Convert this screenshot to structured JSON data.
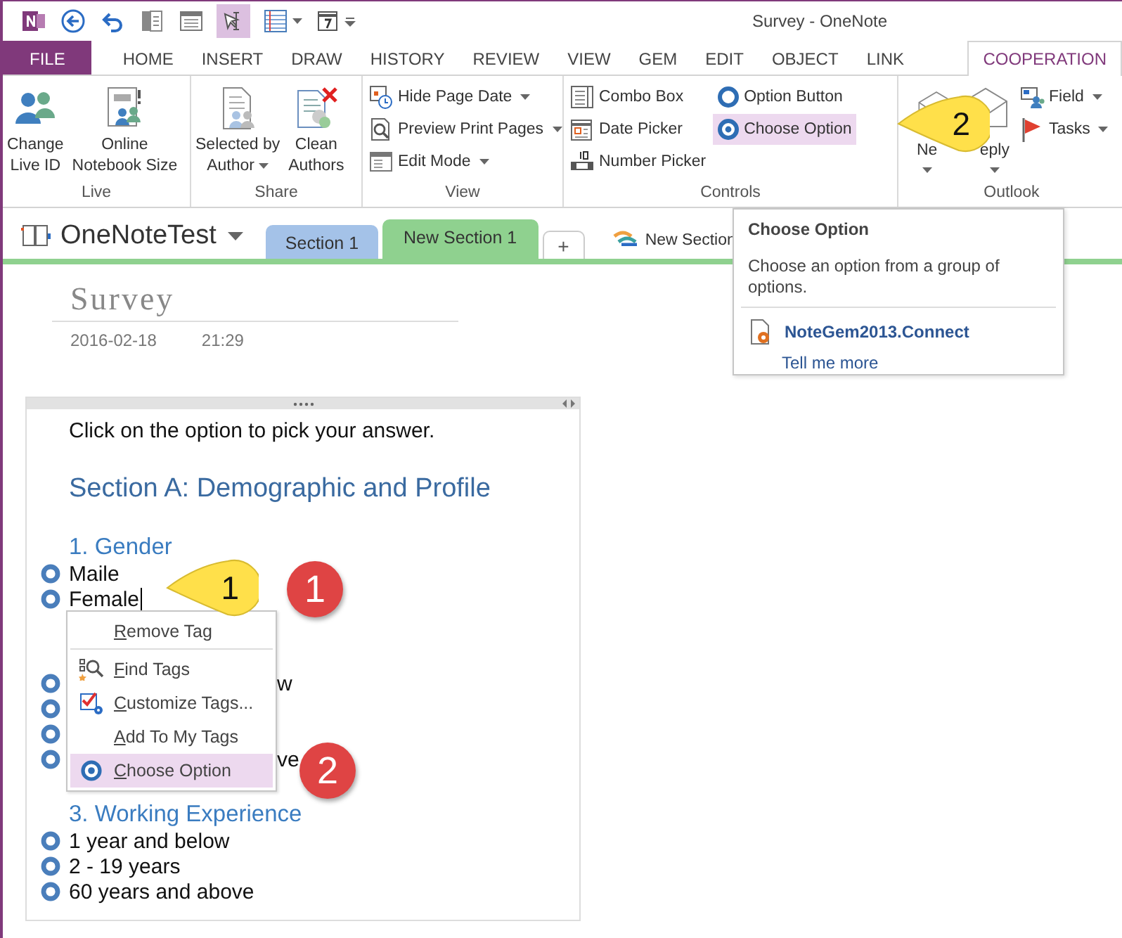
{
  "window": {
    "title": "Survey - OneNote"
  },
  "tabs": [
    {
      "label": "FILE",
      "kind": "file",
      "selected": false
    },
    {
      "label": "HOME",
      "kind": "tab",
      "selected": false
    },
    {
      "label": "INSERT",
      "kind": "tab",
      "selected": false
    },
    {
      "label": "DRAW",
      "kind": "tab",
      "selected": false
    },
    {
      "label": "HISTORY",
      "kind": "tab",
      "selected": false
    },
    {
      "label": "REVIEW",
      "kind": "tab",
      "selected": false
    },
    {
      "label": "VIEW",
      "kind": "tab",
      "selected": false
    },
    {
      "label": "GEM",
      "kind": "tab",
      "selected": false
    },
    {
      "label": "EDIT",
      "kind": "tab",
      "selected": false
    },
    {
      "label": "OBJECT",
      "kind": "tab",
      "selected": false
    },
    {
      "label": "LINK",
      "kind": "tab",
      "selected": false
    },
    {
      "label": "COOPERATION",
      "kind": "tab",
      "selected": true
    }
  ],
  "ribbon_groups": [
    {
      "label": "Live",
      "items": [
        {
          "kind": "large",
          "lines": [
            "Change",
            "Live ID"
          ],
          "dropdown": false
        },
        {
          "kind": "large",
          "lines": [
            "Online",
            "Notebook Size"
          ],
          "dropdown": false
        }
      ]
    },
    {
      "label": "Share",
      "items": [
        {
          "kind": "large",
          "lines": [
            "Selected by",
            "Author"
          ],
          "dropdown": true
        },
        {
          "kind": "large",
          "lines": [
            "Clean",
            "Authors"
          ],
          "dropdown": false
        }
      ]
    },
    {
      "label": "View",
      "items": [
        {
          "kind": "small",
          "lines": [
            "Hide Page Date"
          ],
          "dropdown": true,
          "highlighted": false
        },
        {
          "kind": "small",
          "lines": [
            "Preview Print Pages"
          ],
          "dropdown": true,
          "highlighted": false
        },
        {
          "kind": "small",
          "lines": [
            "Edit Mode"
          ],
          "dropdown": true,
          "highlighted": false
        }
      ]
    },
    {
      "label": "Controls",
      "items": [
        {
          "kind": "small",
          "lines": [
            "Combo Box"
          ],
          "dropdown": false,
          "highlighted": false
        },
        {
          "kind": "small",
          "lines": [
            "Date Picker"
          ],
          "dropdown": false,
          "highlighted": false
        },
        {
          "kind": "small",
          "lines": [
            "Number Picker"
          ],
          "dropdown": false,
          "highlighted": false
        },
        {
          "kind": "small",
          "lines": [
            "Option Button"
          ],
          "dropdown": false,
          "highlighted": false
        },
        {
          "kind": "small",
          "lines": [
            "Choose Option"
          ],
          "dropdown": false,
          "highlighted": true
        }
      ]
    },
    {
      "label": "Outlook",
      "items": [
        {
          "kind": "large",
          "lines": [
            "Ne"
          ],
          "dropdown": true
        },
        {
          "kind": "large",
          "lines": [
            "eply"
          ],
          "dropdown": true
        },
        {
          "kind": "small",
          "lines": [
            "Field"
          ],
          "dropdown": true,
          "highlighted": false
        },
        {
          "kind": "small",
          "lines": [
            "Tasks"
          ],
          "dropdown": true,
          "highlighted": false
        }
      ]
    }
  ],
  "notebook": {
    "name": "OneNoteTest"
  },
  "sections": [
    {
      "label": "Section 1",
      "color": "#a4c2e8",
      "selected": false
    },
    {
      "label": "New Section 1",
      "color": "#8fd18f",
      "selected": true
    }
  ],
  "add_section": "+",
  "section_group": "New Section",
  "page": {
    "title": "Survey",
    "date": "2016-02-18",
    "time": "21:29"
  },
  "note": {
    "instruction": "Click on the option to pick your answer.",
    "section_heading": "Section A: Demographic and Profile",
    "questions": [
      {
        "heading": "1. Gender",
        "options": [
          {
            "text": "Maile",
            "cursor": false,
            "covered": false
          },
          {
            "text": "Female",
            "cursor": true,
            "covered": false
          }
        ]
      },
      {
        "options": [
          {
            "text": "w",
            "cursor": false,
            "covered": true
          },
          {
            "covered": true
          },
          {
            "covered": true
          },
          {
            "text": "ve",
            "cursor": false,
            "covered": true
          }
        ]
      },
      {
        "heading": "3. Working Experience",
        "options": [
          {
            "text": "1 year and below",
            "cursor": false,
            "covered": false
          },
          {
            "text": "2 - 19 years",
            "cursor": false,
            "covered": false
          },
          {
            "text": "60 years and above",
            "cursor": false,
            "covered": false
          }
        ]
      }
    ]
  },
  "context_menu": [
    {
      "label": "Remove Tag",
      "selected": false,
      "separator_after": true
    },
    {
      "label": "Find Tags",
      "selected": false,
      "separator_after": false
    },
    {
      "label": "Customize Tags...",
      "selected": false,
      "separator_after": false
    },
    {
      "label": "Add To My Tags",
      "selected": false,
      "separator_after": false
    },
    {
      "label": "Choose Option",
      "selected": true,
      "separator_after": false
    }
  ],
  "tooltip": {
    "title": "Choose Option",
    "description": "Choose an option from a group of options.",
    "addin": "NoteGem2013.Connect",
    "link": "Tell me more"
  },
  "callouts": [
    {
      "kind": "yellow",
      "label": "1"
    },
    {
      "kind": "red",
      "label": "1"
    },
    {
      "kind": "red",
      "label": "2"
    },
    {
      "kind": "yellow",
      "label": "2"
    }
  ]
}
